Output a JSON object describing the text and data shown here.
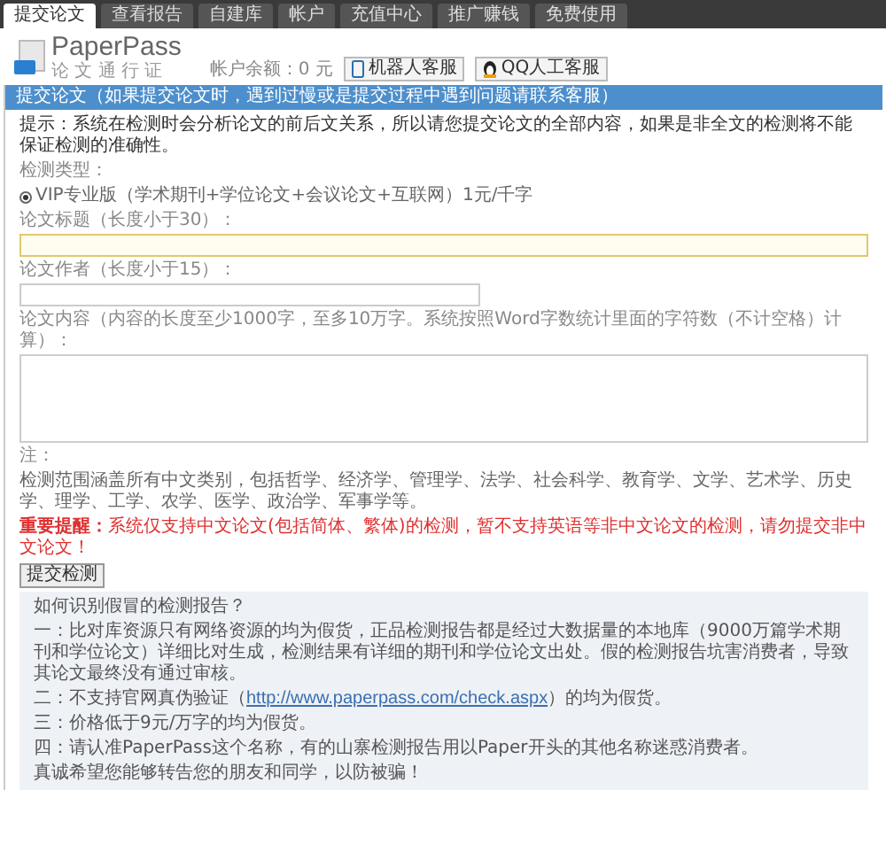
{
  "tabs": [
    {
      "label": "提交论文",
      "selected": true
    },
    {
      "label": "查看报告",
      "selected": false
    },
    {
      "label": "自建库",
      "selected": false
    },
    {
      "label": "帐户",
      "selected": false
    },
    {
      "label": "充值中心",
      "selected": false
    },
    {
      "label": "推广赚钱",
      "selected": false
    },
    {
      "label": "免费使用",
      "selected": false
    }
  ],
  "header": {
    "logo": "PaperPass",
    "logo_subtitle": "论 文 通 行 证",
    "balance": "帐户余额：0 元",
    "buttons": [
      "机器人客服",
      "QQ人工客服"
    ]
  },
  "section_title": "提交论文（如果提交论文时，遇到过慢或是提交过程中遇到问题请联系客服）",
  "hint": "提示：系统在检测时会分析论文的前后文关系，所以请您提交论文的全部内容，如果是非全文的检测将不能保证检测的准确性。",
  "check_type": {
    "label": "检测类型：",
    "options": [
      {
        "label": "VIP专业版（学术期刊+学位论文+会议论文+互联网）1元/千字",
        "selected": true
      }
    ]
  },
  "fields": [
    {
      "label": "论文标题（长度小于30）：",
      "kind": "wide"
    },
    {
      "label": "论文作者（长度小于15）：",
      "kind": "short"
    },
    {
      "label": "论文内容（内容的长度至少1000字，至多10万字。系统按照Word字数统计里面的字符数（不计空格）计算）：",
      "kind": "textarea"
    }
  ],
  "note": {
    "label": "注：",
    "text": "检测范围涵盖所有中文类别，包括哲学、经济学、管理学、法学、社会科学、教育学、文学、艺术学、历史学、理学、工学、农学、医学、政治学、军事学等。"
  },
  "warning": {
    "label": "重要提醒：",
    "text": "系统仅支持中文论文(包括简体、繁体)的检测，暂不支持英语等非中文论文的检测，请勿提交非中文论文！"
  },
  "submit": "提交检测",
  "info": {
    "title": "如何识别假冒的检测报告？",
    "items": [
      {
        "text": "一：比对库资源只有网络资源的均为假货，正品检测报告都是经过大数据量的本地库（9000万篇学术期刊和学位论文）详细比对生成，检测结果有详细的期刊和学位论文出处。假的检测报告坑害消费者，导致其论文最终没有通过审核。"
      },
      {
        "text": "二：不支持官网真伪验证（",
        "link": "http://www.paperpass.com/check.aspx",
        "after": "）的均为假货。"
      },
      {
        "text": "三：价格低于9元/万字的均为假货。"
      },
      {
        "text": "四：请认准PaperPass这个名称，有的山寨检测报告用以Paper开头的其他名称迷惑消费者。"
      },
      {
        "text": "真诚希望您能够转告您的朋友和同学，以防被骗！"
      }
    ]
  }
}
